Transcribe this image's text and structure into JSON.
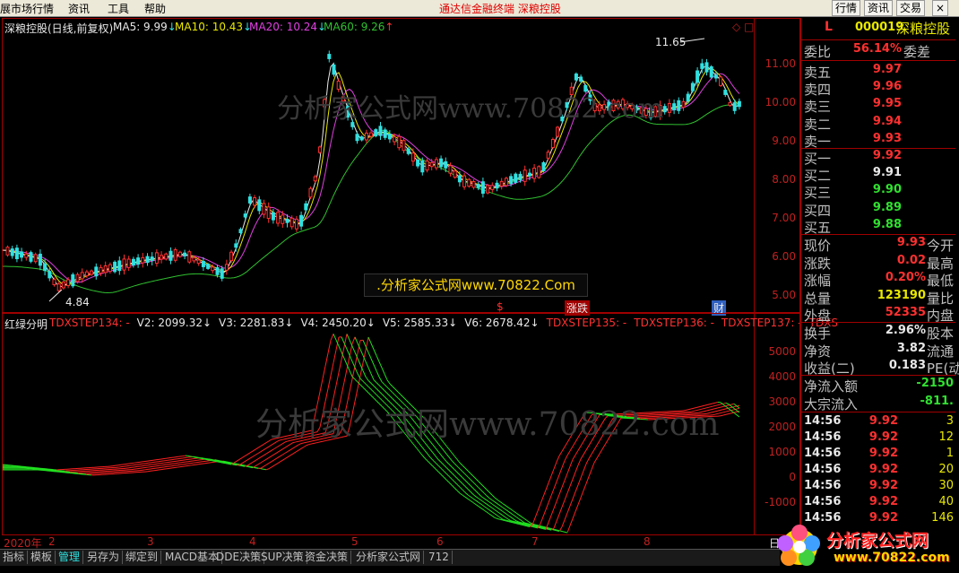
{
  "menu": {
    "items": [
      "展市场行情",
      "资讯",
      "工具",
      "帮助"
    ],
    "center": "通达信金融终端  深粮控股",
    "right_buttons": [
      "行情",
      "资讯",
      "交易"
    ],
    "close": "×"
  },
  "main_chart": {
    "title": "深粮控股(日线,前复权)",
    "ma5": "MA5: 9.99",
    "ma10": "MA10: 10.43",
    "ma20": "MA20: 10.24",
    "ma60": "MA60: 9.26",
    "ma5_arrow": "↓",
    "ma10_arrow": "↓",
    "ma20_arrow": "↓",
    "ma60_arrow": "↑",
    "high_label": "11.65",
    "low_label": "4.84",
    "y_ticks": [
      "11.00",
      "10.00",
      "9.00",
      "8.00",
      "7.00",
      "6.00",
      "5.00"
    ],
    "markers": [
      "$",
      "涨跌",
      "财"
    ],
    "corner": "◇ □"
  },
  "indicator": {
    "name": "红绿分明",
    "items": [
      {
        "text": "TDXSTEP134: -",
        "color": "#ff3030"
      },
      {
        "text": "V2: 2099.32↓",
        "color": "#e8e8e8"
      },
      {
        "text": "V3: 2281.83↓",
        "color": "#e8e8e8"
      },
      {
        "text": "V4: 2450.20↓",
        "color": "#e8e8e8"
      },
      {
        "text": "V5: 2585.33↓",
        "color": "#e8e8e8"
      },
      {
        "text": "V6: 2678.42↓",
        "color": "#e8e8e8"
      },
      {
        "text": "TDXSTEP135: -",
        "color": "#ff3030"
      },
      {
        "text": "TDXSTEP136: -",
        "color": "#ff3030"
      },
      {
        "text": "TDXSTEP137: -",
        "color": "#ff3030"
      },
      {
        "text": "TDXS",
        "color": "#ff3030"
      }
    ],
    "y_ticks": [
      "5000",
      "4000",
      "3000",
      "2000",
      "1000",
      "0",
      "-1000"
    ]
  },
  "watermark": "分析家公式网www.70822.com",
  "ad_banner": ".分析家公式网www.70822.Com",
  "date_axis": {
    "year": "2020年",
    "labels": [
      "2",
      "3",
      "4",
      "5",
      "6",
      "7",
      "8"
    ],
    "corner": "日"
  },
  "bottom_tabs": [
    "指标",
    "模板",
    "管理",
    "另存为",
    "绑定到",
    "MACD基本",
    "DDE决策",
    "SUP决策",
    "资金决策",
    "分析家公式网",
    "712"
  ],
  "quote_panel": {
    "marker": "L",
    "code": "000019",
    "name": "深粮控股",
    "weibi_label": "委比",
    "weibi_value": "56.14%",
    "weicha_label": "委差",
    "asks": [
      {
        "label": "卖五",
        "price": "9.97"
      },
      {
        "label": "卖四",
        "price": "9.96"
      },
      {
        "label": "卖三",
        "price": "9.95"
      },
      {
        "label": "卖二",
        "price": "9.94"
      },
      {
        "label": "卖一",
        "price": "9.93"
      }
    ],
    "bids": [
      {
        "label": "买一",
        "price": "9.92",
        "color": "#ff3030"
      },
      {
        "label": "买二",
        "price": "9.91",
        "color": "#e8e8e8"
      },
      {
        "label": "买三",
        "price": "9.90",
        "color": "#30e030"
      },
      {
        "label": "买四",
        "price": "9.89",
        "color": "#30e030"
      },
      {
        "label": "买五",
        "price": "9.88",
        "color": "#30e030"
      }
    ],
    "stats": [
      {
        "label": "现价",
        "value": "9.93",
        "color": "#ff3030",
        "right": "今开"
      },
      {
        "label": "涨跌",
        "value": "0.02",
        "color": "#ff3030",
        "right": "最高"
      },
      {
        "label": "涨幅",
        "value": "0.20%",
        "color": "#ff3030",
        "right": "最低"
      },
      {
        "label": "总量",
        "value": "123190",
        "color": "#e8e800",
        "right": "量比"
      },
      {
        "label": "外盘",
        "value": "52335",
        "color": "#ff3030",
        "right": "内盘"
      }
    ],
    "stats2": [
      {
        "label": "换手",
        "value": "2.96%",
        "color": "#e8e8e8",
        "right": "股本"
      },
      {
        "label": "净资",
        "value": "3.82",
        "color": "#e8e8e8",
        "right": "流通"
      },
      {
        "label": "收益(二)",
        "value": "0.183",
        "color": "#e8e8e8",
        "right": "PE(动)"
      }
    ],
    "flows": [
      {
        "label": "净流入额",
        "value": "-2150",
        "color": "#30e030"
      },
      {
        "label": "大宗流入",
        "value": "-811.",
        "color": "#30e030"
      }
    ],
    "ticks": [
      {
        "time": "14:56",
        "price": "9.92",
        "vol": "3"
      },
      {
        "time": "14:56",
        "price": "9.92",
        "vol": "12"
      },
      {
        "time": "14:56",
        "price": "9.92",
        "vol": "1"
      },
      {
        "time": "14:56",
        "price": "9.92",
        "vol": "20"
      },
      {
        "time": "14:56",
        "price": "9.92",
        "vol": "30"
      },
      {
        "time": "14:56",
        "price": "9.92",
        "vol": "40"
      },
      {
        "time": "14:56",
        "price": "9.92",
        "vol": "146"
      }
    ]
  },
  "logo_text": "分析家公式网",
  "logo_url": "www.70822.com",
  "colors": {
    "up": "#ff3030",
    "down": "#30e0e0",
    "frame": "#a00000",
    "ma5": "#e8e8e8",
    "ma10": "#e8e800",
    "ma20": "#e040e0",
    "ma60": "#30c030"
  }
}
